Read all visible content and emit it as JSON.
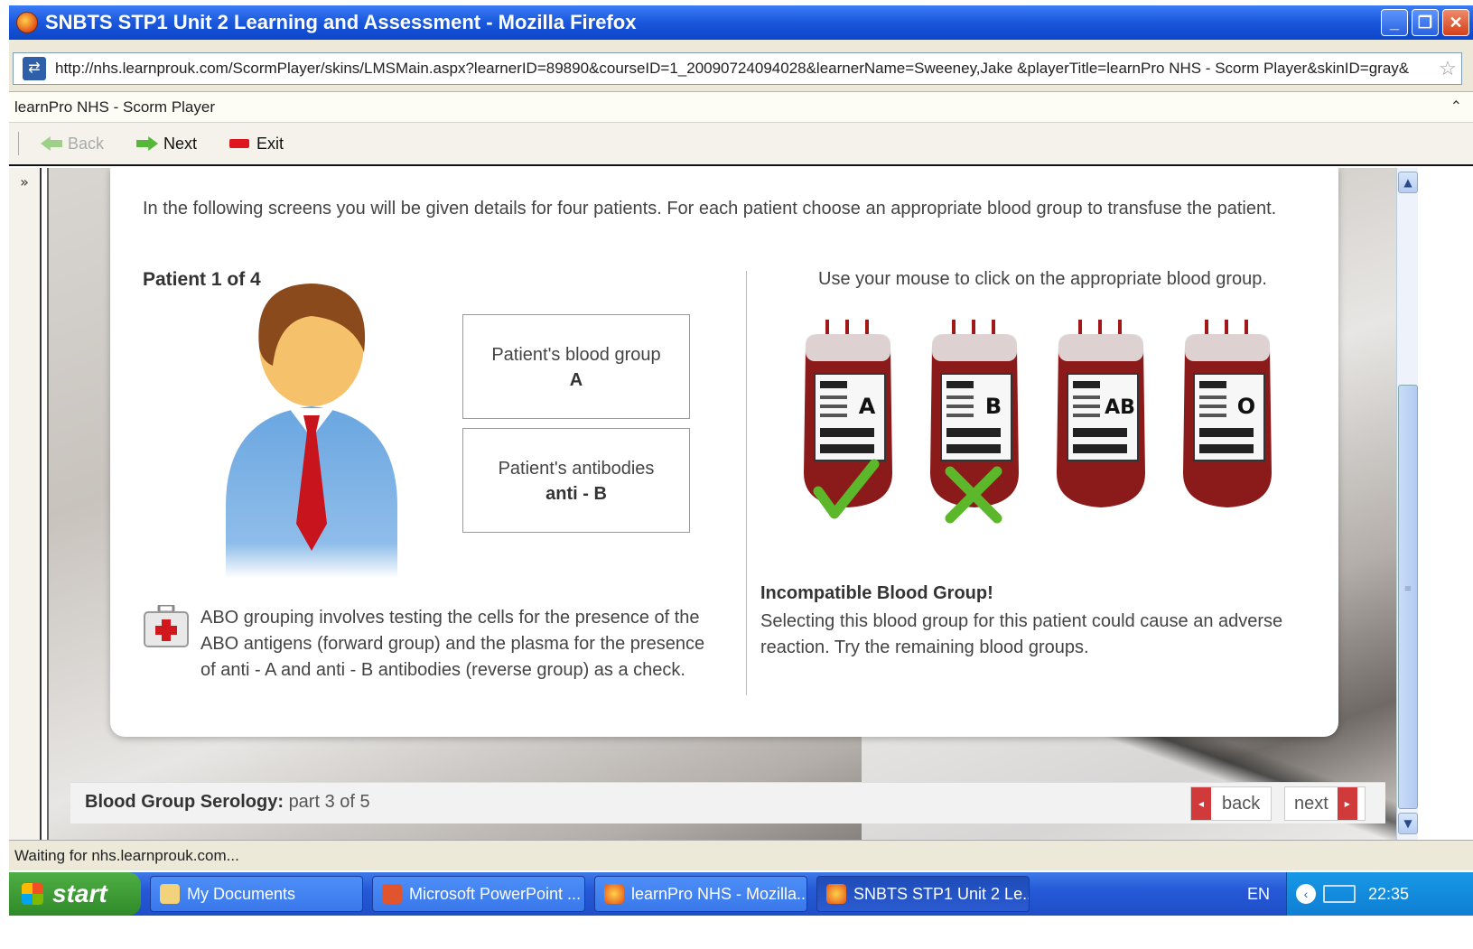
{
  "window": {
    "title": "SNBTS STP1 Unit 2 Learning and Assessment - Mozilla Firefox",
    "buttons": {
      "minimize": "_",
      "restore": "❐",
      "close": "✕"
    }
  },
  "address": {
    "url": "http://nhs.learnprouk.com/ScormPlayer/skins/LMSMain.aspx?learnerID=89890&courseID=1_20090724094028&learnerName=Sweeney,Jake &playerTitle=learnPro NHS - Scorm Player&skinID=gray&"
  },
  "page_title": "learnPro NHS - Scorm Player",
  "toolbar": {
    "back": "Back",
    "next": "Next",
    "exit": "Exit"
  },
  "sidebar": {
    "toggle": "»"
  },
  "content": {
    "intro": "In the following screens you will be given details for four patients. For each patient choose an appropriate blood group to transfuse the patient.",
    "patient_heading": "Patient 1 of 4",
    "blood_group_label": "Patient's blood group",
    "blood_group_value": "A",
    "antibodies_label": "Patient's antibodies",
    "antibodies_value": "anti - B",
    "note": "ABO grouping involves testing the cells for the presence of the ABO antigens (forward group) and the plasma for the presence of anti - A and anti - B antibodies (reverse group) as a check.",
    "instruction": "Use your mouse to click on the appropriate blood group.",
    "bags": [
      {
        "label": "A",
        "mark": "check"
      },
      {
        "label": "B",
        "mark": "cross"
      },
      {
        "label": "AB",
        "mark": "none"
      },
      {
        "label": "O",
        "mark": "none"
      }
    ],
    "result_heading": "Incompatible Blood Group!",
    "result_text": "Selecting this blood group for this patient could cause an adverse reaction. Try the remaining blood groups.",
    "colors": {
      "bag": "#8b1a1a",
      "check": "#5cb82a",
      "cross": "#5cb82a",
      "accent": "#d03a3a"
    }
  },
  "footer": {
    "section": "Blood Group Serology:",
    "part": "part 3 of 5",
    "back": "back",
    "next": "next"
  },
  "status": "Waiting for nhs.learnprouk.com...",
  "taskbar": {
    "start": "start",
    "tasks": [
      {
        "label": "My Documents",
        "active": false
      },
      {
        "label": "Microsoft PowerPoint ...",
        "active": false
      },
      {
        "label": "learnPro NHS - Mozilla...",
        "active": false
      },
      {
        "label": "SNBTS STP1 Unit 2 Le...",
        "active": true
      }
    ],
    "lang": "EN",
    "clock": "22:35"
  }
}
